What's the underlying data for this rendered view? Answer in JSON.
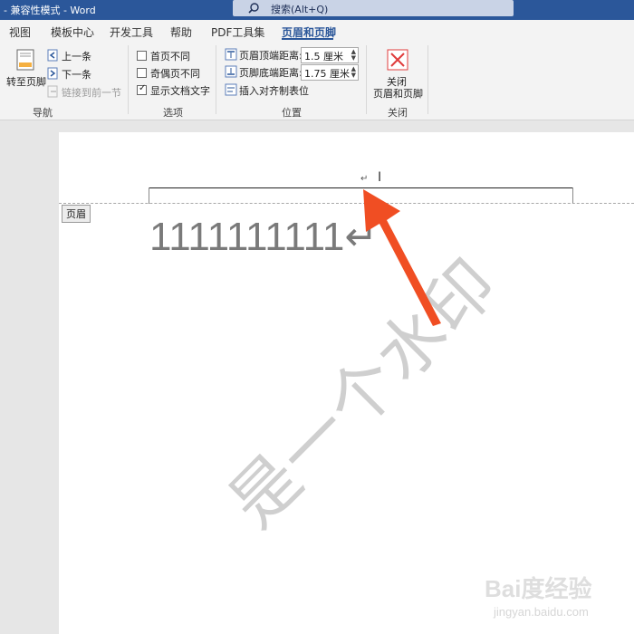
{
  "titlebar": {
    "title": "- 兼容性模式 - Word",
    "search_label": "搜索(Alt+Q)"
  },
  "tabs": [
    "视图",
    "模板中心",
    "开发工具",
    "帮助",
    "PDF工具集",
    "页眉和页脚"
  ],
  "ribbon": {
    "navigation": {
      "goto_footer": "转至页脚",
      "previous": "上一条",
      "next": "下一条",
      "link_previous": "链接到前一节",
      "label": "导航"
    },
    "options": {
      "different_first": "首页不同",
      "different_odd_even": "奇偶页不同",
      "show_doc_text": "显示文档文字",
      "show_doc_text_checked": true,
      "label": "选项"
    },
    "position": {
      "header_top_label": "页眉顶端距离:",
      "header_top_value": "1.5 厘米",
      "footer_bottom_label": "页脚底端距离:",
      "footer_bottom_value": "1.75 厘米",
      "insert_align_tab": "插入对齐制表位",
      "label": "位置"
    },
    "close": {
      "button_line1": "关闭",
      "button_line2": "页眉和页脚",
      "label": "关闭"
    }
  },
  "document": {
    "header_tag": "页眉",
    "header_paragraph_mark": "↵",
    "body_text": "1111111111↵",
    "watermark": "是一个水印",
    "baidu_logo": "Bai度经验",
    "baidu_url": "jingyan.baidu.com"
  },
  "colors": {
    "titlebar": "#2b579a",
    "arrow": "#f04e23",
    "close_icon": "#e03c3c"
  }
}
